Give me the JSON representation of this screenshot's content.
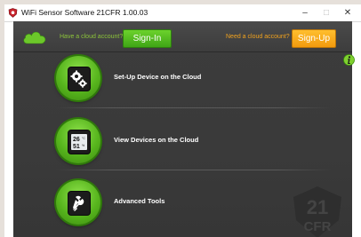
{
  "window": {
    "title": "WiFi Sensor Software 21CFR 1.00.03",
    "controls": {
      "minimize": "–",
      "maximize": "□",
      "close": "✕"
    }
  },
  "topbar": {
    "have_account_text": "Have a cloud account?",
    "signin_label": "Sign-In",
    "need_account_text": "Need a cloud account?",
    "signup_label": "Sign-Up"
  },
  "menu": [
    {
      "label": "Set-Up Device on the Cloud",
      "icon": "gears-icon"
    },
    {
      "label": "View Devices on the Cloud",
      "icon": "device-display-icon"
    },
    {
      "label": "Advanced Tools",
      "icon": "wrench-icon"
    }
  ],
  "device_display": {
    "line1": "26",
    "line1_unit": "°C",
    "line2": "51",
    "line2_unit": "%"
  },
  "watermark": {
    "line1": "21",
    "line2": "CFR"
  },
  "colors": {
    "accent_green": "#57b51d",
    "accent_orange": "#f29a0e",
    "background": "#3a3a3a"
  }
}
